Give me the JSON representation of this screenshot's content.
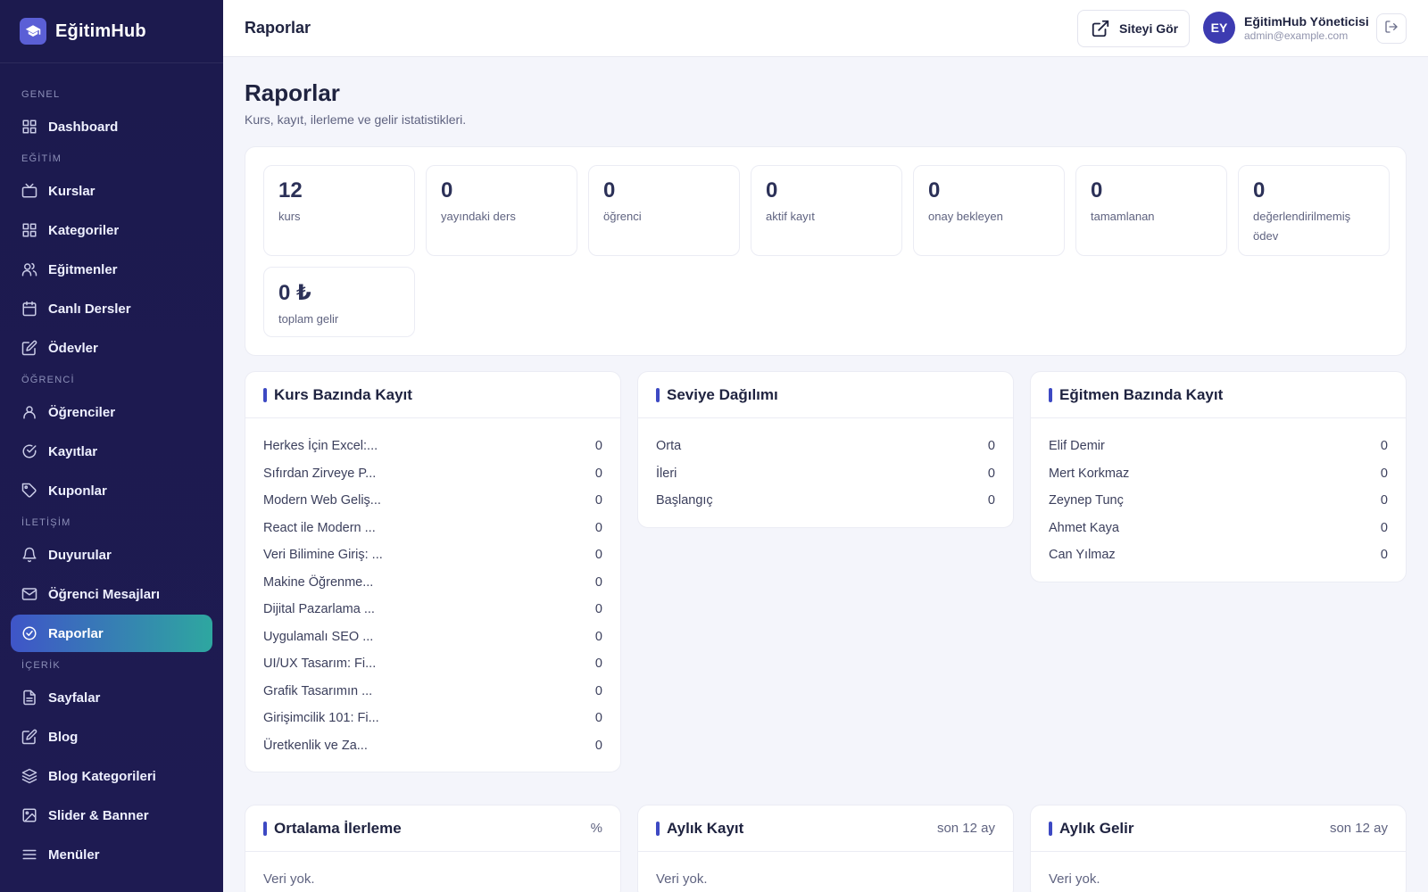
{
  "brand": {
    "name": "EğitimHub",
    "icon": "graduation-cap-icon"
  },
  "sidebar": {
    "groups": [
      {
        "label": "GENEL",
        "items": [
          {
            "label": "Dashboard",
            "icon": "grid-icon"
          }
        ]
      },
      {
        "label": "EĞİTİM",
        "items": [
          {
            "label": "Kurslar",
            "icon": "tv-icon"
          },
          {
            "label": "Kategoriler",
            "icon": "grid-icon"
          },
          {
            "label": "Eğitmenler",
            "icon": "users-icon"
          },
          {
            "label": "Canlı Dersler",
            "icon": "calendar-icon"
          },
          {
            "label": "Ödevler",
            "icon": "edit-icon"
          }
        ]
      },
      {
        "label": "ÖĞRENCİ",
        "items": [
          {
            "label": "Öğrenciler",
            "icon": "user-icon"
          },
          {
            "label": "Kayıtlar",
            "icon": "check-circle-icon"
          },
          {
            "label": "Kuponlar",
            "icon": "tag-icon"
          }
        ]
      },
      {
        "label": "İLETİŞİM",
        "items": [
          {
            "label": "Duyurular",
            "icon": "bell-icon"
          },
          {
            "label": "Öğrenci Mesajları",
            "icon": "mail-icon"
          },
          {
            "label": "Raporlar",
            "icon": "gauge-icon",
            "active": true
          }
        ]
      },
      {
        "label": "İÇERİK",
        "items": [
          {
            "label": "Sayfalar",
            "icon": "file-icon"
          },
          {
            "label": "Blog",
            "icon": "edit-icon"
          },
          {
            "label": "Blog Kategorileri",
            "icon": "layers-icon"
          },
          {
            "label": "Slider & Banner",
            "icon": "image-icon"
          },
          {
            "label": "Menüler",
            "icon": "menu-icon"
          }
        ]
      }
    ]
  },
  "topbar": {
    "title": "Raporlar",
    "site_button": "Siteyi Gör",
    "user": {
      "initials": "EY",
      "name": "EğitimHub Yöneticisi",
      "email": "admin@example.com"
    }
  },
  "page": {
    "title": "Raporlar",
    "subtitle": "Kurs, kayıt, ilerleme ve gelir istatistikleri."
  },
  "stats": [
    {
      "value": "12",
      "label": "kurs"
    },
    {
      "value": "0",
      "label": "yayındaki ders"
    },
    {
      "value": "0",
      "label": "öğrenci"
    },
    {
      "value": "0",
      "label": "aktif kayıt"
    },
    {
      "value": "0",
      "label": "onay bekleyen"
    },
    {
      "value": "0",
      "label": "tamamlanan"
    },
    {
      "value": "0",
      "label": "değerlendirilmemiş ödev"
    },
    {
      "value": "0 ₺",
      "label": "toplam gelir"
    }
  ],
  "panels": {
    "course_enrollment": {
      "title": "Kurs Bazında Kayıt",
      "rows": [
        {
          "name": "Herkes İçin Excel:...",
          "value": "0"
        },
        {
          "name": "Sıfırdan Zirveye P...",
          "value": "0"
        },
        {
          "name": "Modern Web Geliş...",
          "value": "0"
        },
        {
          "name": "React ile Modern ...",
          "value": "0"
        },
        {
          "name": "Veri Bilimine Giriş: ...",
          "value": "0"
        },
        {
          "name": "Makine Öğrenme...",
          "value": "0"
        },
        {
          "name": "Dijital Pazarlama ...",
          "value": "0"
        },
        {
          "name": "Uygulamalı SEO ...",
          "value": "0"
        },
        {
          "name": "UI/UX Tasarım: Fi...",
          "value": "0"
        },
        {
          "name": "Grafik Tasarımın ...",
          "value": "0"
        },
        {
          "name": "Girişimcilik 101: Fi...",
          "value": "0"
        },
        {
          "name": "Üretkenlik ve Za...",
          "value": "0"
        }
      ]
    },
    "level_distribution": {
      "title": "Seviye Dağılımı",
      "rows": [
        {
          "name": "Orta",
          "value": "0"
        },
        {
          "name": "İleri",
          "value": "0"
        },
        {
          "name": "Başlangıç",
          "value": "0"
        }
      ]
    },
    "instructor_enrollment": {
      "title": "Eğitmen Bazında Kayıt",
      "rows": [
        {
          "name": "Elif Demir",
          "value": "0"
        },
        {
          "name": "Mert Korkmaz",
          "value": "0"
        },
        {
          "name": "Zeynep Tunç",
          "value": "0"
        },
        {
          "name": "Ahmet Kaya",
          "value": "0"
        },
        {
          "name": "Can Yılmaz",
          "value": "0"
        }
      ]
    },
    "avg_progress": {
      "title": "Ortalama İlerleme",
      "meta": "%",
      "empty": "Veri yok."
    },
    "monthly_enrollment": {
      "title": "Aylık Kayıt",
      "meta": "son 12 ay",
      "empty": "Veri yok."
    },
    "monthly_revenue": {
      "title": "Aylık Gelir",
      "meta": "son 12 ay",
      "empty": "Veri yok."
    }
  },
  "colors": {
    "sidebar": "#1c1a4e",
    "accent": "#3d49c3",
    "active_gradient_start": "#3f55c8",
    "active_gradient_end": "#2ea7a0"
  }
}
